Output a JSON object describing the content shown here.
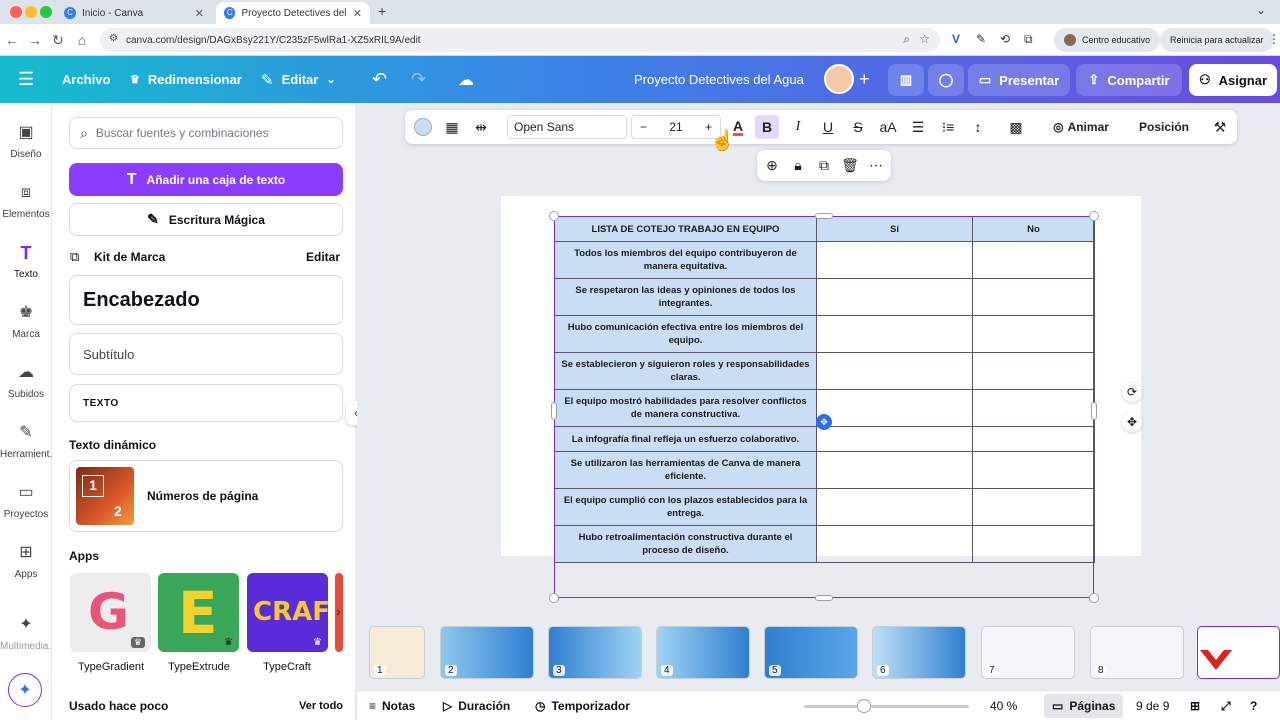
{
  "browser": {
    "tabs": [
      {
        "title": "Inicio - Canva",
        "active": false
      },
      {
        "title": "Proyecto Detectives del Agua",
        "active": true
      }
    ],
    "url": "canva.com/design/DAGxBsy221Y/C235zF5wlRa1-XZ5xRIL9A/edit",
    "profile_chip": "Centro educativo",
    "update_chip": "Reinicia para actualizar"
  },
  "header": {
    "archivo": "Archivo",
    "redimensionar": "Redimensionar",
    "editar": "Editar",
    "project_title": "Proyecto Detectives del Agua",
    "presentar": "Presentar",
    "compartir": "Compartir",
    "asignar": "Asignar"
  },
  "rail": [
    {
      "label": "Diseño",
      "icon": "layout-icon"
    },
    {
      "label": "Elementos",
      "icon": "shapes-icon"
    },
    {
      "label": "Texto",
      "icon": "text-icon"
    },
    {
      "label": "Marca",
      "icon": "brand-icon"
    },
    {
      "label": "Subidos",
      "icon": "cloud-upload-icon"
    },
    {
      "label": "Herramient...",
      "icon": "tools-icon"
    },
    {
      "label": "Proyectos",
      "icon": "folder-icon"
    },
    {
      "label": "Apps",
      "icon": "apps-icon"
    },
    {
      "label": "Multimedia...",
      "icon": "media-icon"
    }
  ],
  "panel": {
    "search_placeholder": "Buscar fuentes y combinaciones",
    "add_text": "Añadir una caja de texto",
    "magic_write": "Escritura Mágica",
    "brand_kit": "Kit de Marca",
    "brand_edit": "Editar",
    "heading": "Encabezado",
    "subheading": "Subtítulo",
    "body": "TEXTO",
    "dynamic_title": "Texto dinámico",
    "page_numbers": "Números de página",
    "apps_title": "Apps",
    "apps": [
      "TypeGradient",
      "TypeExtrude",
      "TypeCraft"
    ],
    "recent_title": "Usado hace poco",
    "see_all": "Ver todo"
  },
  "toolbar": {
    "font": "Open Sans",
    "size": "21",
    "animate": "Animar",
    "position": "Posición"
  },
  "table": {
    "headers": [
      "LISTA DE COTEJO TRABAJO EN EQUIPO",
      "Sí",
      "No"
    ],
    "rows": [
      "Todos los miembros del equipo contribuyeron de manera equitativa.",
      "Se respetaron las ideas y opiniones de todos los integrantes.",
      "Hubo comunicación efectiva entre los miembros del equipo.",
      "Se establecieron y siguieron roles y responsabilidades claras.",
      "El equipo mostró habilidades para resolver conflictos de manera constructiva.",
      "La infografía final refleja un esfuerzo colaborativo.",
      "Se utilizaron las herramientas de Canva de manera eficiente.",
      "El equipo cumplió con los plazos establecidos para la entrega.",
      "Hubo retroalimentación constructiva durante el proceso de diseño."
    ]
  },
  "thumbnails": [
    "1",
    "2",
    "3",
    "4",
    "5",
    "6",
    "7",
    "8"
  ],
  "footer": {
    "notes": "Notas",
    "duration": "Duración",
    "timer": "Temporizador",
    "zoom": "40 %",
    "pages": "Páginas",
    "page_count": "9 de 9"
  }
}
